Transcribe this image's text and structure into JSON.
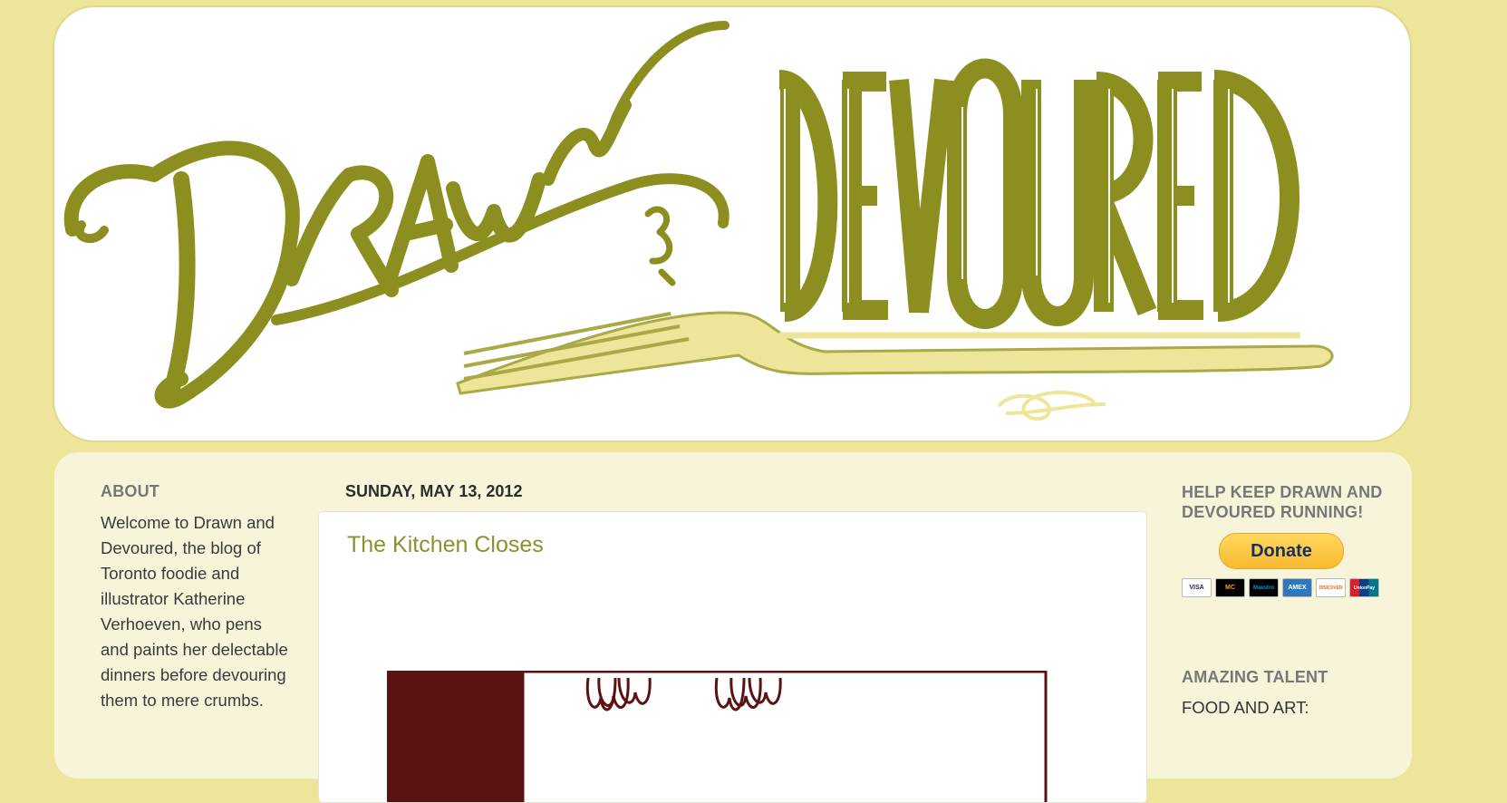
{
  "header": {
    "logo_text": "Drawn & Devoured"
  },
  "sidebar_left": {
    "about_title": "ABOUT",
    "about_text": "Welcome to Drawn and Devoured, the blog of Toronto foodie and illustrator Katherine Verhoeven, who pens and paints her delectable dinners before devouring them to mere crumbs."
  },
  "main": {
    "date_header": "SUNDAY, MAY 13, 2012",
    "post_title": "The Kitchen Closes"
  },
  "sidebar_right": {
    "help_title": "HELP KEEP DRAWN AND DEVOURED RUNNING!",
    "donate_label": "Donate",
    "payment_cards": [
      "VISA",
      "MC",
      "Maestro",
      "AMEX",
      "DISCOVER",
      "UnionPay"
    ],
    "amazing_title": "AMAZING TALENT",
    "amazing_text": "FOOD AND ART:"
  },
  "colors": {
    "page_bg": "#ede59a",
    "header_bg": "#ffffff",
    "content_bg": "#f7f4da",
    "logo_olive": "#8c8f20",
    "logo_pale": "#ede69a",
    "post_title": "#88922f",
    "illustration_maroon": "#5a1212"
  }
}
